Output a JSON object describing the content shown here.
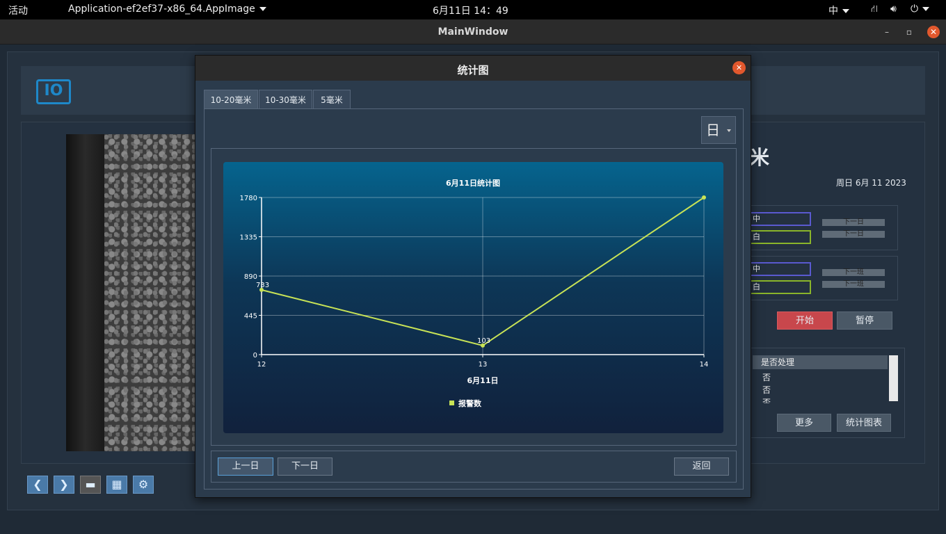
{
  "topbar": {
    "activities": "活动",
    "app_name": "Application-ef2ef37-x86_64.AppImage",
    "clock": "6月11日  14：49",
    "ime": "中"
  },
  "window": {
    "title": "MainWindow",
    "minimize": "–",
    "maximize": "▫",
    "close": "✕"
  },
  "background": {
    "logo": "IO",
    "big_text": "米",
    "date": "周日 6月 11 2023",
    "shift_input_1": "中",
    "shift_input_2": "白",
    "shift_input_3": "中",
    "shift_input_4": "白",
    "next_day_1": "下一日",
    "next_day_2": "下一日",
    "next_shift_1": "下一班",
    "next_shift_2": "下一班",
    "start": "开始",
    "pause": "暂停",
    "table_header": "是否处理",
    "table_rows": [
      "否",
      "否",
      "否"
    ],
    "more": "更多",
    "stats_chart": "统计图表"
  },
  "dialog": {
    "title": "统计图",
    "close": "✕",
    "tabs": [
      "10-20毫米",
      "10-30毫米",
      "5毫米"
    ],
    "period_select": "日",
    "prev_day": "上一日",
    "next_day": "下一日",
    "back": "返回"
  },
  "chart_data": {
    "type": "line",
    "title": "6月11日统计图",
    "xlabel": "6月11日",
    "ylabel": "",
    "x": [
      12,
      13,
      14
    ],
    "y_ticks": [
      0,
      445,
      890,
      1335,
      1780
    ],
    "ylim": [
      0,
      1780
    ],
    "xlim": [
      12,
      14
    ],
    "grid": true,
    "legend_position": "bottom",
    "series": [
      {
        "name": "报警数",
        "values": [
          733,
          103,
          1780
        ],
        "labels": [
          "733",
          "103",
          ""
        ],
        "color": "#c8e356"
      }
    ]
  }
}
